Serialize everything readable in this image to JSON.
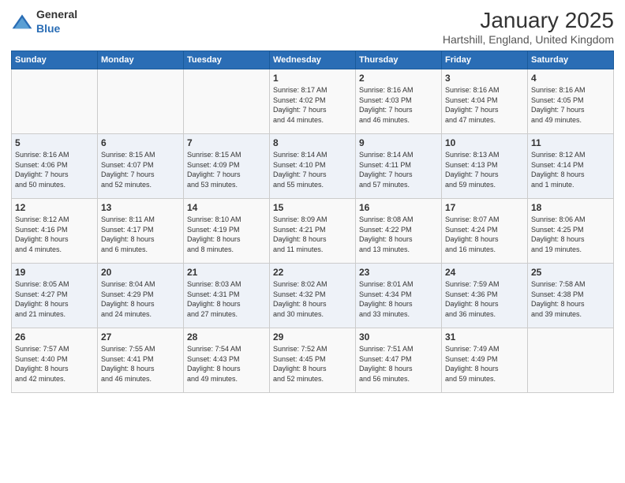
{
  "header": {
    "logo_general": "General",
    "logo_blue": "Blue",
    "title": "January 2025",
    "subtitle": "Hartshill, England, United Kingdom"
  },
  "weekdays": [
    "Sunday",
    "Monday",
    "Tuesday",
    "Wednesday",
    "Thursday",
    "Friday",
    "Saturday"
  ],
  "weeks": [
    [
      {
        "day": "",
        "info": ""
      },
      {
        "day": "",
        "info": ""
      },
      {
        "day": "",
        "info": ""
      },
      {
        "day": "1",
        "info": "Sunrise: 8:17 AM\nSunset: 4:02 PM\nDaylight: 7 hours\nand 44 minutes."
      },
      {
        "day": "2",
        "info": "Sunrise: 8:16 AM\nSunset: 4:03 PM\nDaylight: 7 hours\nand 46 minutes."
      },
      {
        "day": "3",
        "info": "Sunrise: 8:16 AM\nSunset: 4:04 PM\nDaylight: 7 hours\nand 47 minutes."
      },
      {
        "day": "4",
        "info": "Sunrise: 8:16 AM\nSunset: 4:05 PM\nDaylight: 7 hours\nand 49 minutes."
      }
    ],
    [
      {
        "day": "5",
        "info": "Sunrise: 8:16 AM\nSunset: 4:06 PM\nDaylight: 7 hours\nand 50 minutes."
      },
      {
        "day": "6",
        "info": "Sunrise: 8:15 AM\nSunset: 4:07 PM\nDaylight: 7 hours\nand 52 minutes."
      },
      {
        "day": "7",
        "info": "Sunrise: 8:15 AM\nSunset: 4:09 PM\nDaylight: 7 hours\nand 53 minutes."
      },
      {
        "day": "8",
        "info": "Sunrise: 8:14 AM\nSunset: 4:10 PM\nDaylight: 7 hours\nand 55 minutes."
      },
      {
        "day": "9",
        "info": "Sunrise: 8:14 AM\nSunset: 4:11 PM\nDaylight: 7 hours\nand 57 minutes."
      },
      {
        "day": "10",
        "info": "Sunrise: 8:13 AM\nSunset: 4:13 PM\nDaylight: 7 hours\nand 59 minutes."
      },
      {
        "day": "11",
        "info": "Sunrise: 8:12 AM\nSunset: 4:14 PM\nDaylight: 8 hours\nand 1 minute."
      }
    ],
    [
      {
        "day": "12",
        "info": "Sunrise: 8:12 AM\nSunset: 4:16 PM\nDaylight: 8 hours\nand 4 minutes."
      },
      {
        "day": "13",
        "info": "Sunrise: 8:11 AM\nSunset: 4:17 PM\nDaylight: 8 hours\nand 6 minutes."
      },
      {
        "day": "14",
        "info": "Sunrise: 8:10 AM\nSunset: 4:19 PM\nDaylight: 8 hours\nand 8 minutes."
      },
      {
        "day": "15",
        "info": "Sunrise: 8:09 AM\nSunset: 4:21 PM\nDaylight: 8 hours\nand 11 minutes."
      },
      {
        "day": "16",
        "info": "Sunrise: 8:08 AM\nSunset: 4:22 PM\nDaylight: 8 hours\nand 13 minutes."
      },
      {
        "day": "17",
        "info": "Sunrise: 8:07 AM\nSunset: 4:24 PM\nDaylight: 8 hours\nand 16 minutes."
      },
      {
        "day": "18",
        "info": "Sunrise: 8:06 AM\nSunset: 4:25 PM\nDaylight: 8 hours\nand 19 minutes."
      }
    ],
    [
      {
        "day": "19",
        "info": "Sunrise: 8:05 AM\nSunset: 4:27 PM\nDaylight: 8 hours\nand 21 minutes."
      },
      {
        "day": "20",
        "info": "Sunrise: 8:04 AM\nSunset: 4:29 PM\nDaylight: 8 hours\nand 24 minutes."
      },
      {
        "day": "21",
        "info": "Sunrise: 8:03 AM\nSunset: 4:31 PM\nDaylight: 8 hours\nand 27 minutes."
      },
      {
        "day": "22",
        "info": "Sunrise: 8:02 AM\nSunset: 4:32 PM\nDaylight: 8 hours\nand 30 minutes."
      },
      {
        "day": "23",
        "info": "Sunrise: 8:01 AM\nSunset: 4:34 PM\nDaylight: 8 hours\nand 33 minutes."
      },
      {
        "day": "24",
        "info": "Sunrise: 7:59 AM\nSunset: 4:36 PM\nDaylight: 8 hours\nand 36 minutes."
      },
      {
        "day": "25",
        "info": "Sunrise: 7:58 AM\nSunset: 4:38 PM\nDaylight: 8 hours\nand 39 minutes."
      }
    ],
    [
      {
        "day": "26",
        "info": "Sunrise: 7:57 AM\nSunset: 4:40 PM\nDaylight: 8 hours\nand 42 minutes."
      },
      {
        "day": "27",
        "info": "Sunrise: 7:55 AM\nSunset: 4:41 PM\nDaylight: 8 hours\nand 46 minutes."
      },
      {
        "day": "28",
        "info": "Sunrise: 7:54 AM\nSunset: 4:43 PM\nDaylight: 8 hours\nand 49 minutes."
      },
      {
        "day": "29",
        "info": "Sunrise: 7:52 AM\nSunset: 4:45 PM\nDaylight: 8 hours\nand 52 minutes."
      },
      {
        "day": "30",
        "info": "Sunrise: 7:51 AM\nSunset: 4:47 PM\nDaylight: 8 hours\nand 56 minutes."
      },
      {
        "day": "31",
        "info": "Sunrise: 7:49 AM\nSunset: 4:49 PM\nDaylight: 8 hours\nand 59 minutes."
      },
      {
        "day": "",
        "info": ""
      }
    ]
  ]
}
